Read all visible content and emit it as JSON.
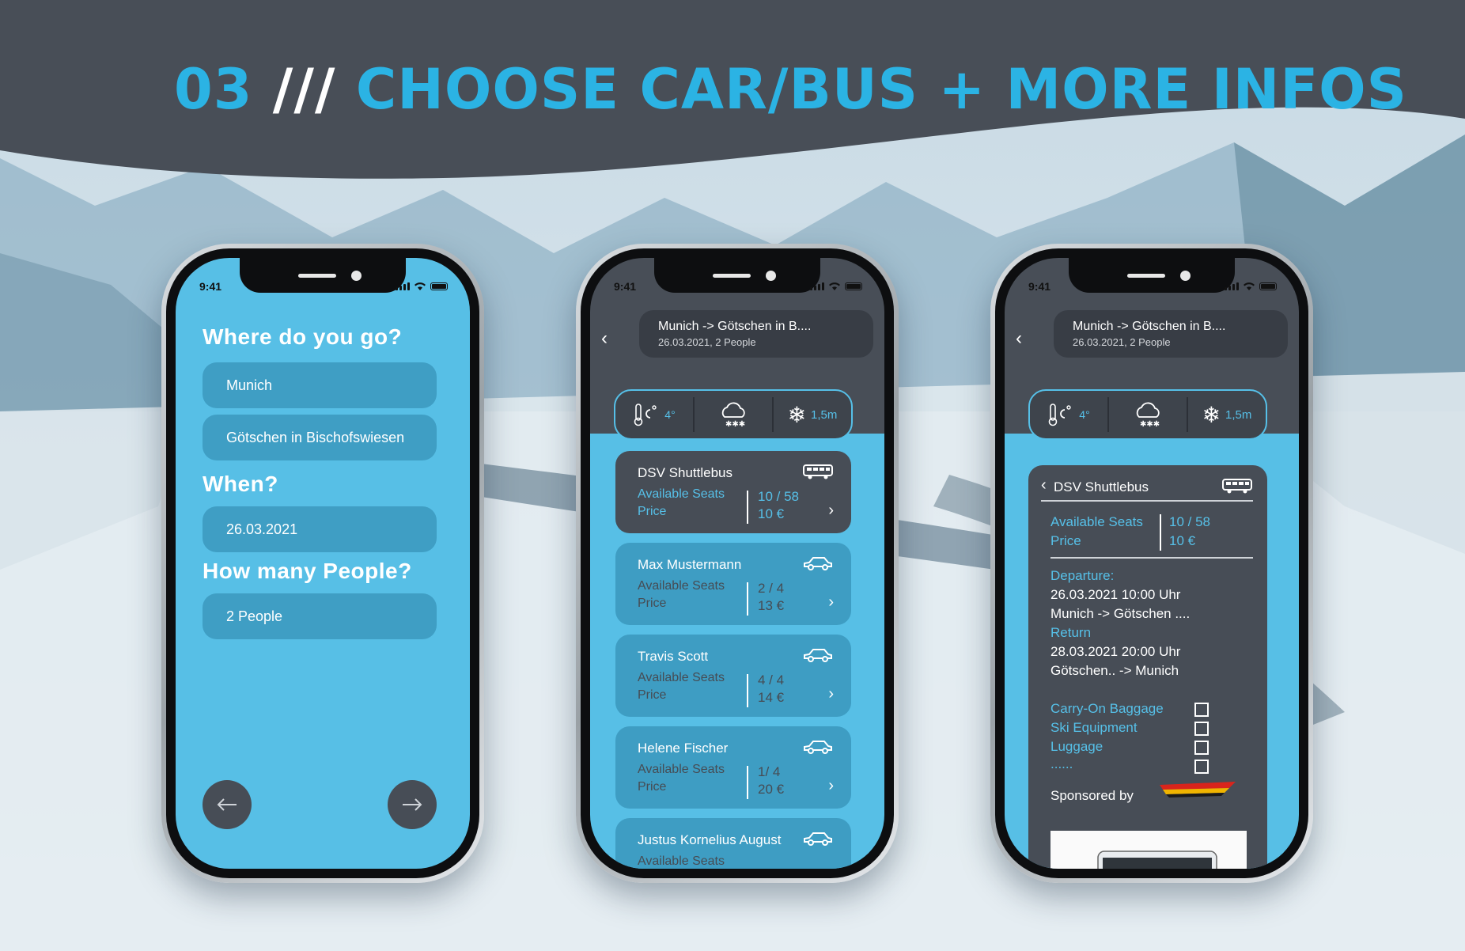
{
  "page": {
    "title_prefix": "03",
    "title_slashes": " /// ",
    "title_main": "CHOOSE CAR/BUS + MORE INFOS",
    "colors": {
      "accent": "#2bb3e4",
      "dark": "#474d56",
      "blue": "#57bfe6"
    }
  },
  "status_bar": {
    "time": "9:41"
  },
  "phone1": {
    "q_where": "Where do you go?",
    "from": "Munich",
    "to": "Götschen in Bischofswiesen",
    "q_when": "When?",
    "date": "26.03.2021",
    "q_people": "How many People?",
    "people": "2 People",
    "back_icon": "arrow-left-icon",
    "next_icon": "arrow-right-icon"
  },
  "trip": {
    "route": "Munich -> Götschen in B....",
    "details": "26.03.2021, 2 People"
  },
  "weather": {
    "temp": "4°",
    "snow_depth": "1,5m",
    "icons": [
      "thermometer-icon",
      "snow-cloud-icon",
      "snowflake-icon"
    ]
  },
  "labels": {
    "available_seats": "Available Seats",
    "price": "Price"
  },
  "rides": [
    {
      "name": "DSV Shuttlebus",
      "seats": "10 / 58",
      "price": "10 €",
      "vehicle": "bus-icon",
      "selected": true
    },
    {
      "name": "Max Mustermann",
      "seats": "2 / 4",
      "price": "13 €",
      "vehicle": "car-icon",
      "selected": false
    },
    {
      "name": "Travis Scott",
      "seats": "4 / 4",
      "price": "14 €",
      "vehicle": "car-icon",
      "selected": false
    },
    {
      "name": "Helene Fischer",
      "seats": "1/ 4",
      "price": "20 €",
      "vehicle": "car-icon",
      "selected": false
    },
    {
      "name": "Justus Kornelius August",
      "seats": "",
      "price": "",
      "vehicle": "car-icon",
      "selected": false
    }
  ],
  "detail": {
    "name": "DSV Shuttlebus",
    "seats": "10 / 58",
    "price": "10 €",
    "departure_label": "Departure:",
    "departure_time": "26.03.2021  10:00 Uhr",
    "departure_route": "Munich -> Götschen ....",
    "return_label": "Return",
    "return_time": "28.03.2021  20:00 Uhr",
    "return_route": "Götschen.. -> Munich",
    "options": [
      "Carry-On Baggage",
      "Ski Equipment",
      "Luggage",
      "......"
    ],
    "sponsored_by": "Sponsored by"
  }
}
